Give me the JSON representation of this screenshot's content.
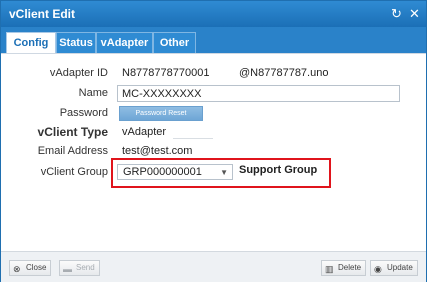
{
  "window": {
    "title": "vClient Edit",
    "refresh_icon": "refresh-icon",
    "close_icon": "close-icon"
  },
  "tabs": [
    {
      "label": "Config",
      "active": true
    },
    {
      "label": "Status",
      "active": false
    },
    {
      "label": "vAdapter",
      "active": false
    },
    {
      "label": "Other",
      "active": false
    }
  ],
  "form": {
    "vadapter_id": {
      "label": "vAdapter ID",
      "value": "N8778778770001",
      "suffix": "@N87787787.uno"
    },
    "name": {
      "label": "Name",
      "value": "MC-XXXXXXXX"
    },
    "password": {
      "label": "Password",
      "button": "Password Reset"
    },
    "vclient_type": {
      "label": "vClient Type",
      "value": "vAdapter"
    },
    "email": {
      "label": "Email Address",
      "value": "test@test.com"
    },
    "vclient_group": {
      "label": "vClient Group",
      "value": "GRP000000001",
      "note": "Support Group"
    }
  },
  "footer": {
    "close": "Close",
    "send": "Send",
    "delete": "Delete",
    "update": "Update"
  },
  "colors": {
    "titlebar": "#1b6fb6",
    "highlight": "#e0141c"
  }
}
